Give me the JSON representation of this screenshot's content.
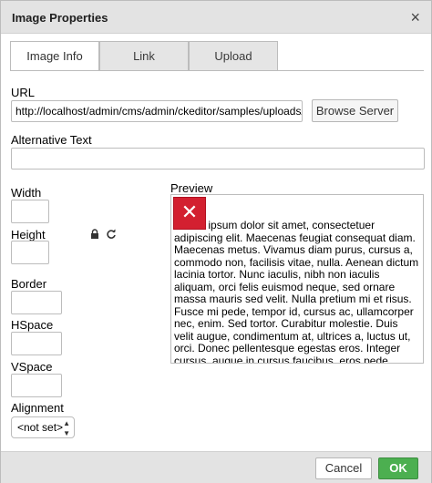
{
  "dialog": {
    "title": "Image Properties",
    "close_symbol": "×"
  },
  "tabs": [
    {
      "label": "Image Info"
    },
    {
      "label": "Link"
    },
    {
      "label": "Upload"
    }
  ],
  "url": {
    "label": "URL",
    "value": "http://localhost/admin/cms/admin/ckeditor/samples/uploads/Scre",
    "browse_label": "Browse Server"
  },
  "alt_text": {
    "label": "Alternative Text",
    "value": ""
  },
  "dimensions": {
    "width_label": "Width",
    "height_label": "Height",
    "width_value": "",
    "height_value": "",
    "lock_icon": "lock-icon",
    "reset_icon": "reset-icon"
  },
  "border": {
    "label": "Border",
    "value": ""
  },
  "hspace": {
    "label": "HSpace",
    "value": ""
  },
  "vspace": {
    "label": "VSpace",
    "value": ""
  },
  "alignment": {
    "label": "Alignment",
    "value": "<not set>"
  },
  "preview": {
    "label": "Preview",
    "text": "Lorem ipsum dolor sit amet, consectetuer adipiscing elit. Maecenas feugiat consequat diam. Maecenas metus. Vivamus diam purus, cursus a, commodo non, facilisis vitae, nulla. Aenean dictum lacinia tortor. Nunc iaculis, nibh non iaculis aliquam, orci felis euismod neque, sed ornare massa mauris sed velit. Nulla pretium mi et risus. Fusce mi pede, tempor id, cursus ac, ullamcorper nec, enim. Sed tortor. Curabitur molestie. Duis velit augue, condimentum at, ultrices a, luctus ut, orci. Donec pellentesque egestas eros. Integer cursus, augue in cursus faucibus, eros pede bibendum sem, in tempus tellus justo quis ligula. Etiam eget tortor. Vestibulum rutrum, est ut placerat elementum, lectus"
  },
  "footer": {
    "cancel_label": "Cancel",
    "ok_label": "OK"
  },
  "colors": {
    "ok_button": "#4caf50",
    "broken_image": "#d32030"
  }
}
